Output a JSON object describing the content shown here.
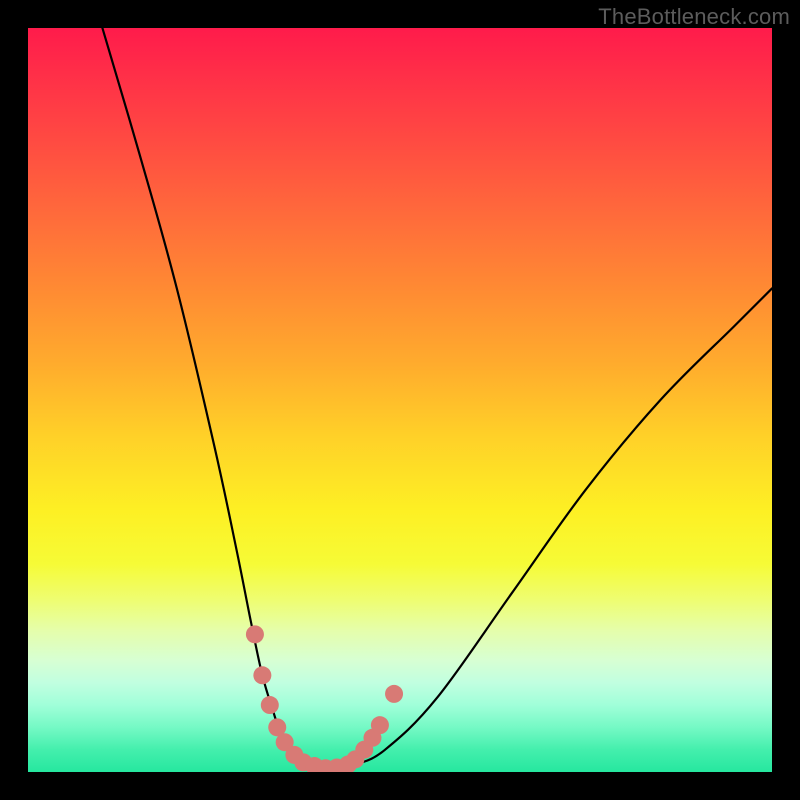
{
  "watermark": "TheBottleneck.com",
  "chart_data": {
    "type": "line",
    "title": "",
    "xlabel": "",
    "ylabel": "",
    "xlim": [
      0,
      100
    ],
    "ylim": [
      0,
      100
    ],
    "series": [
      {
        "name": "bottleneck-curve",
        "x": [
          10,
          15,
          20,
          25,
          28,
          30,
          31.5,
          33,
          34,
          35,
          36,
          38,
          40,
          42,
          44,
          48,
          55,
          65,
          75,
          85,
          95,
          100
        ],
        "y": [
          100,
          83,
          65,
          44,
          30,
          20,
          13,
          8,
          5,
          3,
          2,
          1,
          0.5,
          0.5,
          1,
          3,
          10,
          24,
          38,
          50,
          60,
          65
        ]
      }
    ],
    "markers": {
      "name": "highlight-dots",
      "color": "#d87a75",
      "points_xy": [
        [
          30.5,
          18.5
        ],
        [
          31.5,
          13.0
        ],
        [
          32.5,
          9.0
        ],
        [
          33.5,
          6.0
        ],
        [
          34.5,
          4.0
        ],
        [
          35.8,
          2.3
        ],
        [
          37.0,
          1.3
        ],
        [
          38.5,
          0.8
        ],
        [
          40.0,
          0.5
        ],
        [
          41.5,
          0.6
        ],
        [
          43.0,
          1.0
        ],
        [
          44.0,
          1.7
        ],
        [
          45.2,
          3.0
        ],
        [
          46.3,
          4.6
        ],
        [
          47.3,
          6.3
        ],
        [
          49.2,
          10.5
        ]
      ]
    },
    "gradient_stops": [
      {
        "pos": 0.0,
        "color": "#ff1b4b"
      },
      {
        "pos": 0.3,
        "color": "#ff7a37"
      },
      {
        "pos": 0.6,
        "color": "#ffe026"
      },
      {
        "pos": 0.8,
        "color": "#e9fe8a"
      },
      {
        "pos": 1.0,
        "color": "#26e79f"
      }
    ]
  }
}
